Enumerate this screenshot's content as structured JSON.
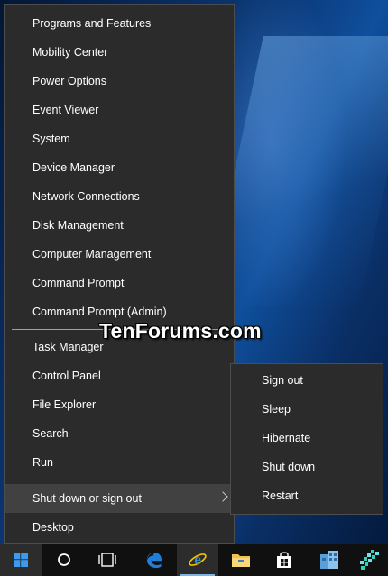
{
  "menu": {
    "items_group1": [
      "Programs and Features",
      "Mobility Center",
      "Power Options",
      "Event Viewer",
      "System",
      "Device Manager",
      "Network Connections",
      "Disk Management",
      "Computer Management",
      "Command Prompt",
      "Command Prompt (Admin)"
    ],
    "items_group2": [
      "Task Manager",
      "Control Panel",
      "File Explorer",
      "Search",
      "Run"
    ],
    "shutdown_label": "Shut down or sign out",
    "desktop_label": "Desktop"
  },
  "submenu": {
    "items": [
      "Sign out",
      "Sleep",
      "Hibernate",
      "Shut down",
      "Restart"
    ]
  },
  "watermark": "TenForums.com",
  "taskbar": {
    "icons": [
      "windows-start-icon",
      "cortana-search-icon",
      "task-view-icon",
      "edge-icon",
      "internet-explorer-icon",
      "file-explorer-icon",
      "store-icon",
      "app-icon",
      "app-icon-2"
    ]
  },
  "colors": {
    "menu_bg": "#2b2b2b",
    "highlight": "#414141",
    "accent": "#0078d7"
  }
}
